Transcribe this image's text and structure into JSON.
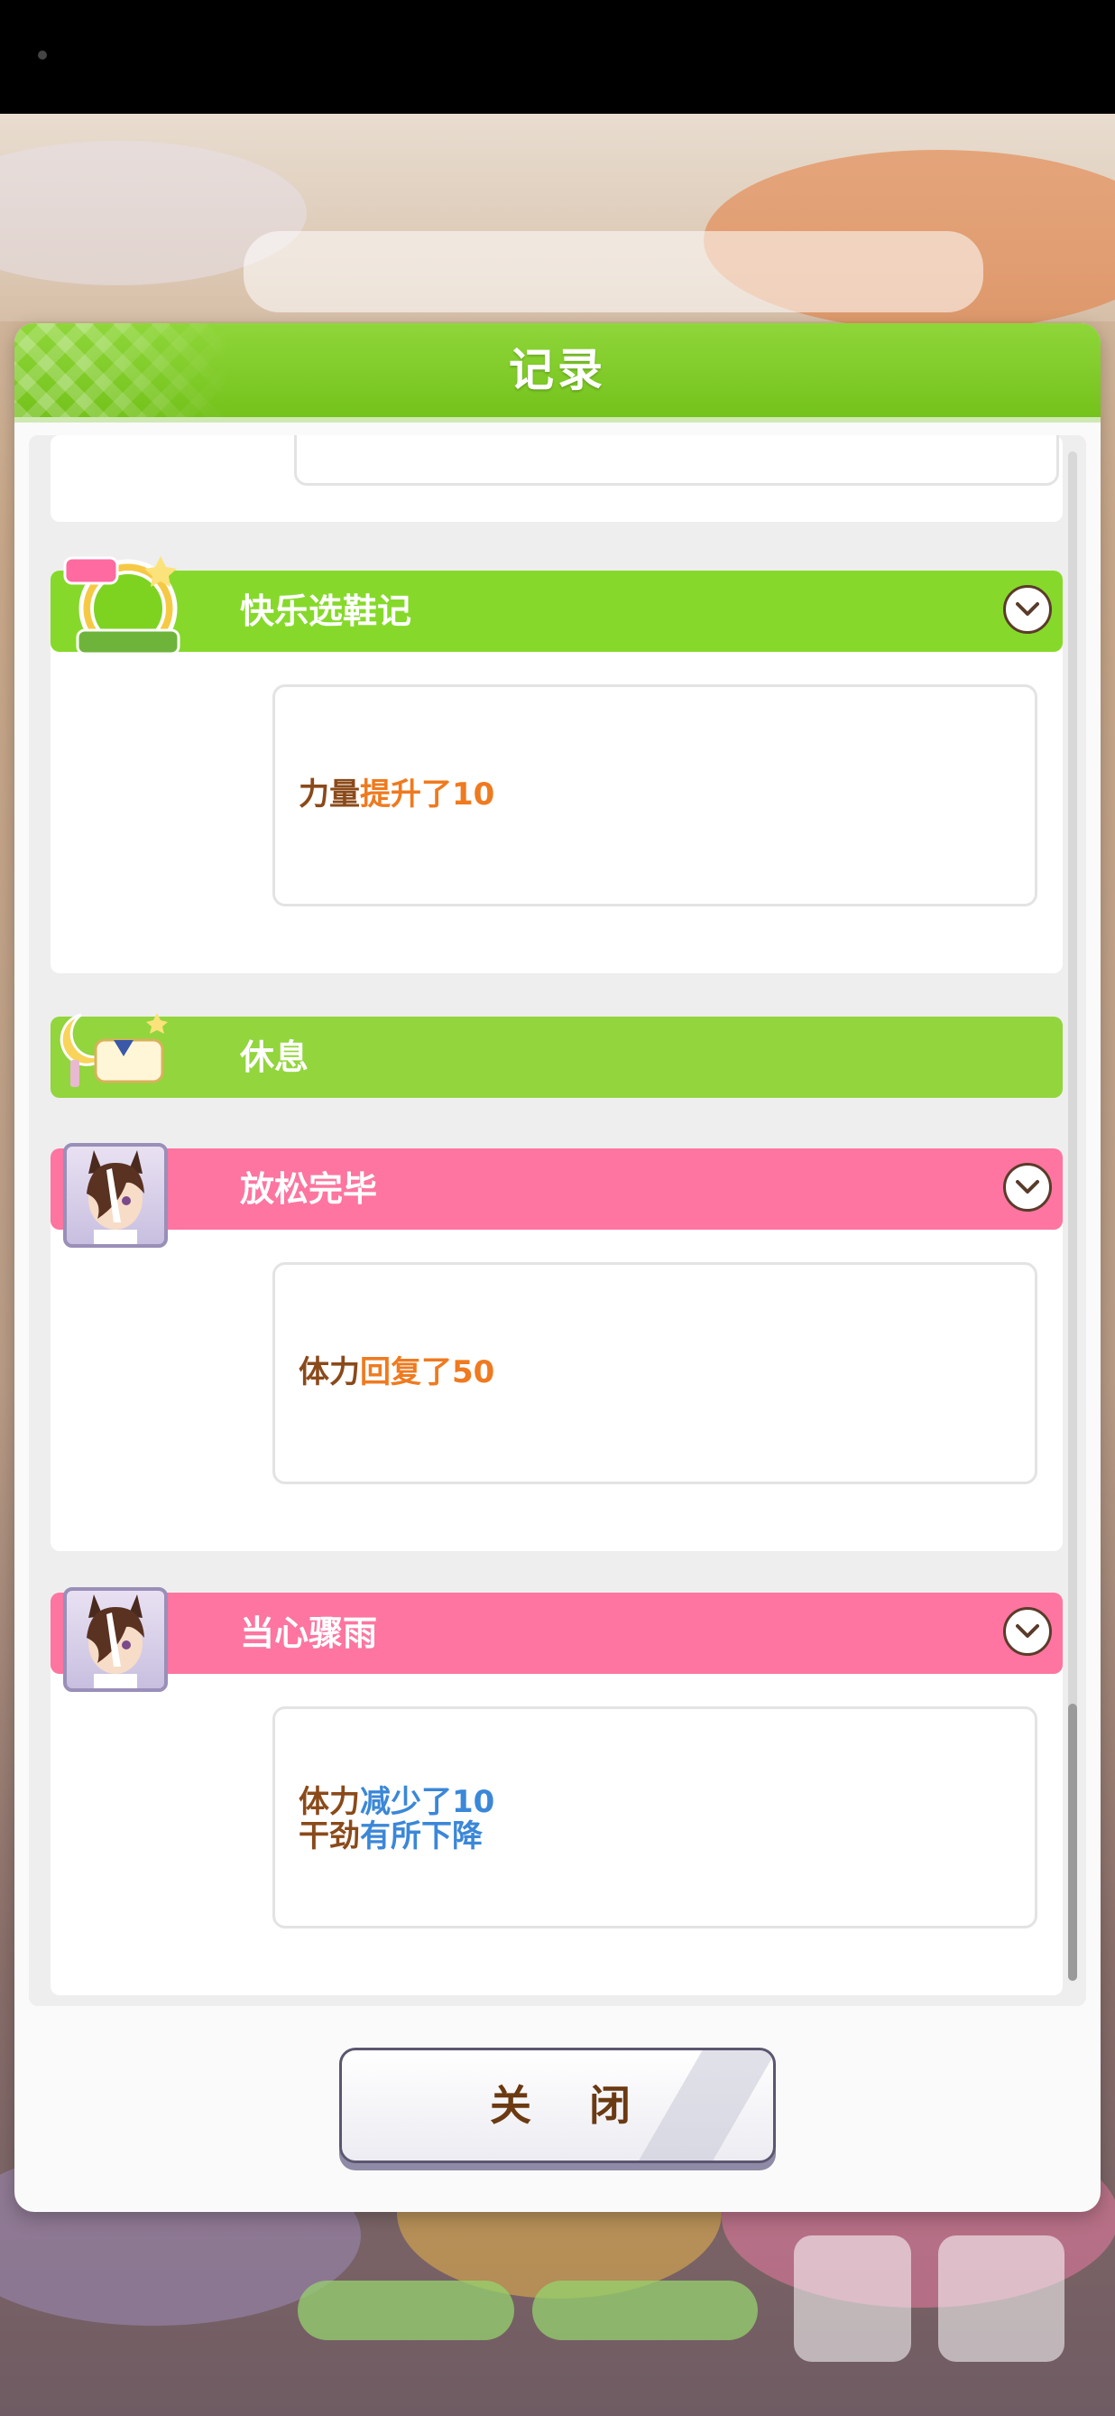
{
  "modal": {
    "title": "记录",
    "close_label": "关 闭"
  },
  "events": [
    {
      "title": "快乐选鞋记",
      "icon": "ura-finals-badge-icon",
      "bar_color": "#86d92a",
      "lines": [
        {
          "label": "力量",
          "change": "提升了10",
          "tone": "positive"
        }
      ]
    },
    {
      "title": "休息",
      "icon": "rest-moon-bed-icon",
      "bar_color": "#92d53d",
      "lines": []
    },
    {
      "title": "放松完毕",
      "icon": "character-avatar",
      "bar_color": "#fd75a0",
      "lines": [
        {
          "label": "体力",
          "change": "回复了50",
          "tone": "positive"
        }
      ]
    },
    {
      "title": "当心骤雨",
      "icon": "character-avatar",
      "bar_color": "#fd75a0",
      "lines": [
        {
          "label": "体力",
          "change": "减少了10",
          "tone": "negative"
        },
        {
          "label": "干劲",
          "change": "有所下降",
          "tone": "negative"
        }
      ]
    }
  ],
  "colors": {
    "header_green": "#74c21b",
    "pink": "#fd75a0",
    "label_brown": "#8a4a1a",
    "positive_orange": "#ef7a1f",
    "negative_blue": "#3b87d8"
  }
}
